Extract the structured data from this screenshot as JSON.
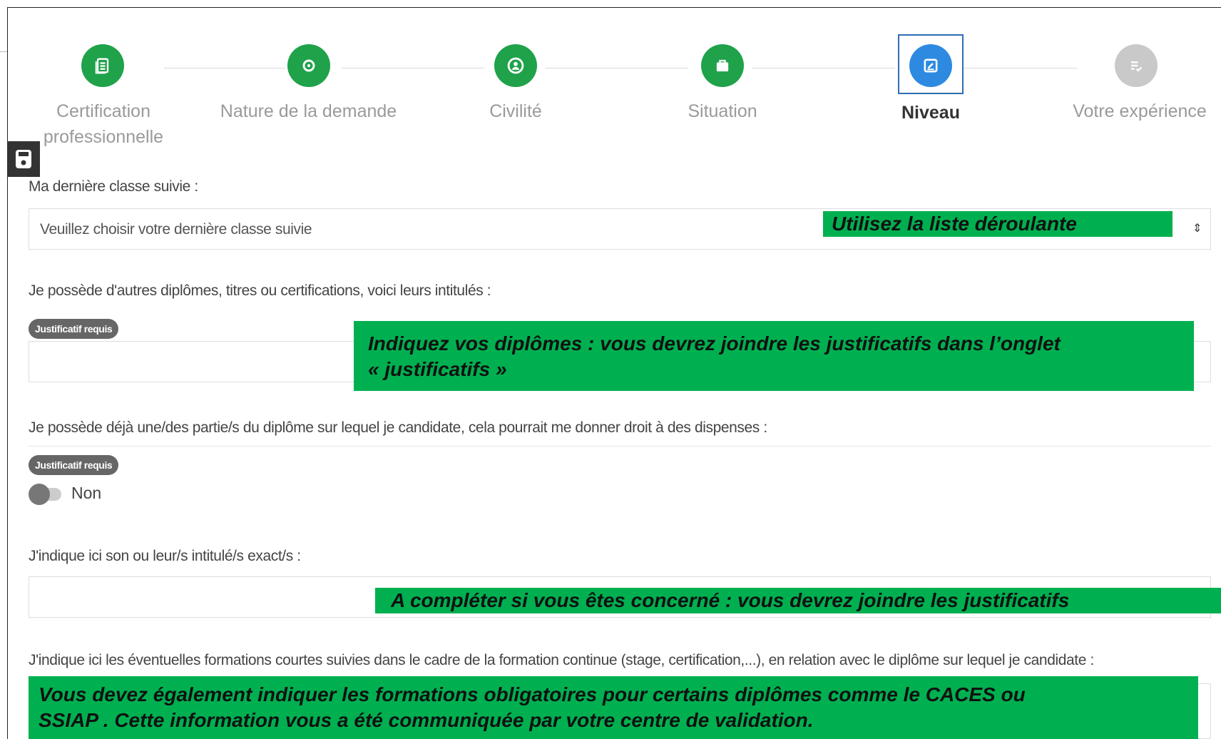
{
  "stepper": {
    "steps": [
      {
        "label": "Certification professionnelle",
        "icon": "document-list-icon",
        "state": "done"
      },
      {
        "label": "Nature de la demande",
        "icon": "target-icon",
        "state": "done"
      },
      {
        "label": "Civilité",
        "icon": "user-icon",
        "state": "done"
      },
      {
        "label": "Situation",
        "icon": "briefcase-icon",
        "state": "done"
      },
      {
        "label": "Niveau",
        "icon": "edit-icon",
        "state": "active"
      },
      {
        "label": "Votre expérience",
        "icon": "list-check-icon",
        "state": "pending"
      }
    ],
    "colors": {
      "done": "#1fa24a",
      "active": "#2d8ae0",
      "pending": "#c9c9c9"
    }
  },
  "save_tab": {
    "icon": "save-icon"
  },
  "form": {
    "last_class": {
      "label": "Ma dernière classe suivie :",
      "placeholder": "Veuillez choisir votre dernière classe suivie"
    },
    "other_diplomas": {
      "label": "Je possède d'autres diplômes, titres ou certifications, voici leurs intitulés :",
      "badge": "Justificatif requis",
      "value": ""
    },
    "partial_diploma": {
      "label": "Je possède déjà une/des partie/s du diplôme sur lequel je candidate, cela pourrait me donner droit à des dispenses :",
      "badge": "Justificatif requis",
      "toggle_label": "Non"
    },
    "exact_titles": {
      "label": "J'indique ici son ou leur/s intitulé/s exact/s :",
      "value": ""
    },
    "short_trainings": {
      "label": "J'indique ici les éventuelles formations courtes suivies dans le cadre de la formation continue (stage, certification,...), en relation avec le diplôme sur lequel je candidate :"
    }
  },
  "annotations": {
    "select_hint": "Utilisez la liste déroulante",
    "diplomas_hint_line1": "Indiquez vos diplômes : vous devrez joindre les justificatifs dans l’onglet",
    "diplomas_hint_line2": "« justificatifs »",
    "complete_hint": "A compléter si vous êtes concerné : vous devrez joindre les justificatifs",
    "trainings_hint_line1": "Vous devez également indiquer les formations obligatoires pour certains diplômes comme le CACES ou",
    "trainings_hint_line2": "SSIAP . Cette information vous a été communiquée par votre centre de validation.",
    "color": "#00b050"
  }
}
